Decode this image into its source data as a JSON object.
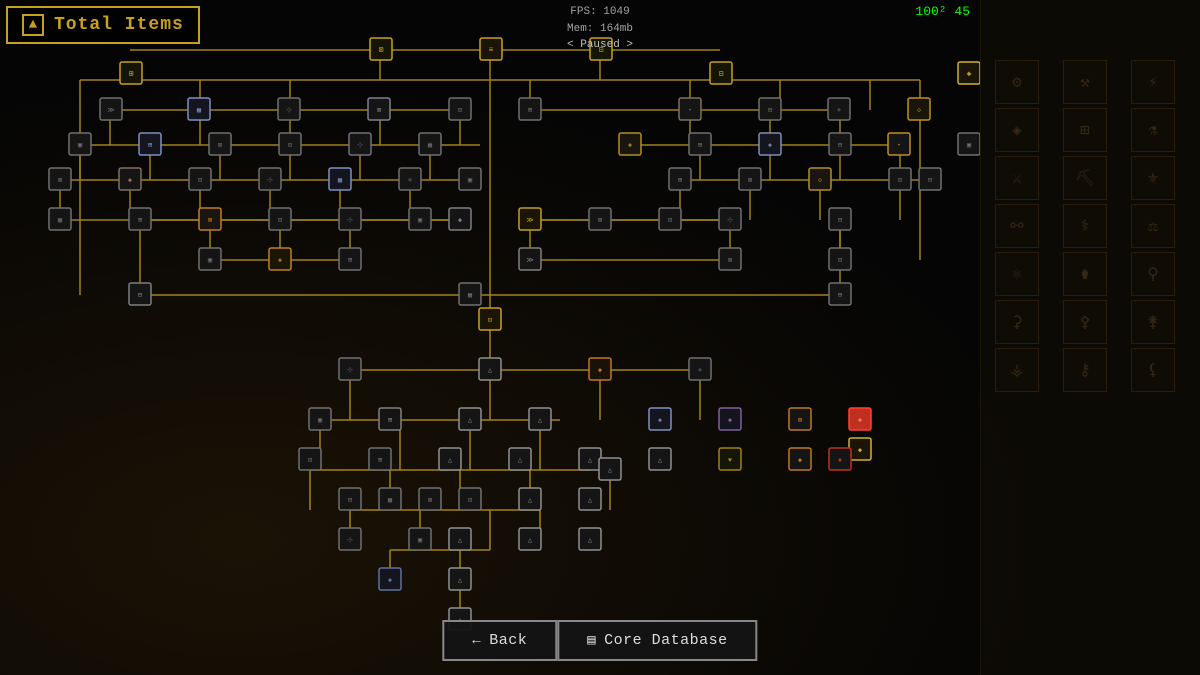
{
  "title": {
    "label": "Total Items",
    "back_arrow": "▲"
  },
  "hud": {
    "fps": "FPS: 1049",
    "mem": "Mem: 164mb",
    "paused": "< Paused >",
    "counter": "100² 45"
  },
  "buttons": {
    "back": {
      "label": "Back",
      "icon": "←"
    },
    "core_database": {
      "label": "Core Database",
      "icon": "▤"
    }
  },
  "colors": {
    "gold": "#c8a020",
    "dark_bg": "#080808"
  }
}
